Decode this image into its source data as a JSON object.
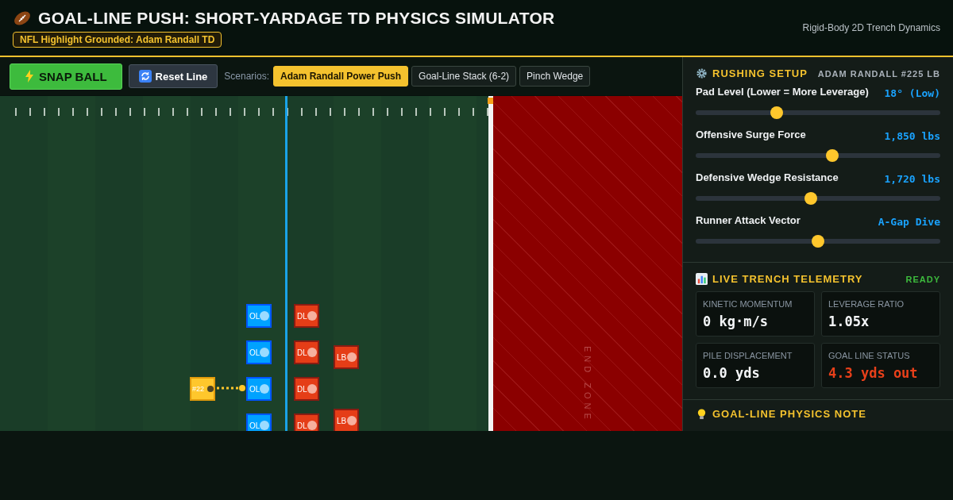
{
  "header": {
    "title": "GOAL-LINE PUSH: SHORT-YARDAGE TD PHYSICS SIMULATOR",
    "badge": "NFL Highlight Grounded: Adam Randall TD",
    "subtitle": "Rigid-Body 2D Trench Dynamics"
  },
  "toolbar": {
    "snap_button": "SNAP BALL",
    "reset_button": "Reset Line",
    "scenarios_label": "Scenarios:",
    "scenarios": [
      {
        "label": "Adam Randall Power Push",
        "selected": true
      },
      {
        "label": "Goal-Line Stack (6-2)",
        "selected": false
      },
      {
        "label": "Pinch Wedge",
        "selected": false
      }
    ]
  },
  "field": {
    "end_zone_label": "END ZONE",
    "offensive_line": [
      {
        "label": "OL"
      },
      {
        "label": "OL"
      },
      {
        "label": "OL"
      },
      {
        "label": "OL"
      }
    ],
    "defensive_line": [
      {
        "label": "DL"
      },
      {
        "label": "DL"
      },
      {
        "label": "DL"
      },
      {
        "label": "DL"
      }
    ],
    "linebackers": [
      {
        "label": "LB"
      },
      {
        "label": "LB"
      }
    ],
    "runner": {
      "label": "#22"
    }
  },
  "rushing_setup": {
    "title": "RUSHING SETUP",
    "player": "ADAM RANDALL #225 LB",
    "sliders": [
      {
        "label": "Pad Level (Lower = More Leverage)",
        "reading": "18° (Low)",
        "level": 0.33
      },
      {
        "label": "Offensive Surge Force",
        "reading": "1,850 lbs",
        "level": 0.56
      },
      {
        "label": "Defensive Wedge Resistance",
        "reading": "1,720 lbs",
        "level": 0.47
      },
      {
        "label": "Runner Attack Vector",
        "reading": "A-Gap Dive",
        "level": 0.5
      }
    ]
  },
  "telemetry": {
    "title": "LIVE TRENCH TELEMETRY",
    "status": "READY",
    "metrics": [
      {
        "label": "KINETIC MOMENTUM",
        "value": "0 kg·m/s",
        "alert": false
      },
      {
        "label": "LEVERAGE RATIO",
        "value": "1.05x",
        "alert": false
      },
      {
        "label": "PILE DISPLACEMENT",
        "value": "0.0 yds",
        "alert": false
      },
      {
        "label": "GOAL LINE STATUS",
        "value": "4.3 yds out",
        "alert": true
      }
    ]
  },
  "note": {
    "title": "GOAL-LINE PHYSICS NOTE"
  }
}
